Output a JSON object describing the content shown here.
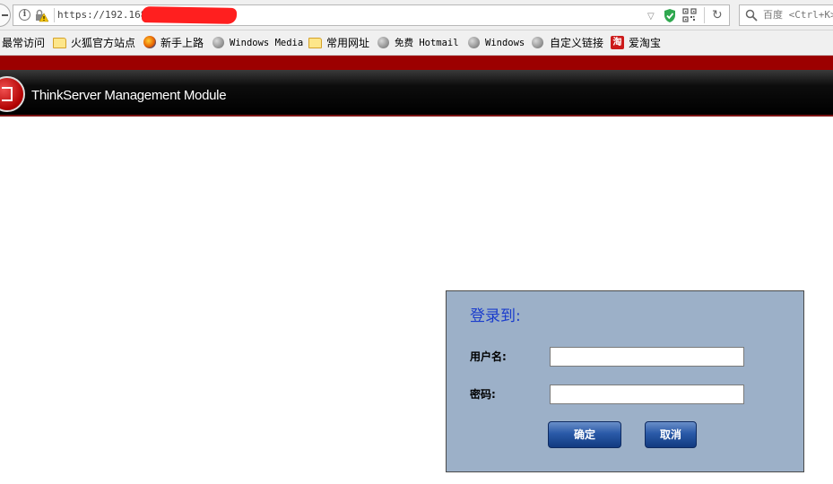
{
  "browser": {
    "url": "https://192.168.",
    "search_placeholder": "百度 <Ctrl+K>",
    "bookmarks": [
      {
        "label": "最常访问",
        "icon": "none"
      },
      {
        "label": "火狐官方站点",
        "icon": "folder-icon"
      },
      {
        "label": "新手上路",
        "icon": "firefox-icon"
      },
      {
        "label": "Windows Media",
        "icon": "globe-icon"
      },
      {
        "label": "常用网址",
        "icon": "folder-icon"
      },
      {
        "label": "免费 Hotmail",
        "icon": "globe-icon"
      },
      {
        "label": "Windows",
        "icon": "globe-icon"
      },
      {
        "label": "自定义链接",
        "icon": "globe-icon"
      },
      {
        "label": "爱淘宝",
        "icon": "taobao-icon"
      }
    ],
    "taobao_glyph": "淘"
  },
  "app": {
    "title": "ThinkServer Management Module"
  },
  "login": {
    "heading": "登录到:",
    "username_label": "用户名:",
    "username_value": "",
    "password_label": "密码:",
    "password_value": "",
    "ok_button": "确定",
    "cancel_button": "取消"
  },
  "colors": {
    "header_red": "#9c0000",
    "login_bg": "#9cb0c8",
    "login_heading": "#1a3ccc",
    "button_blue": "#2a5aa8",
    "redaction": "#ff1f1f"
  }
}
